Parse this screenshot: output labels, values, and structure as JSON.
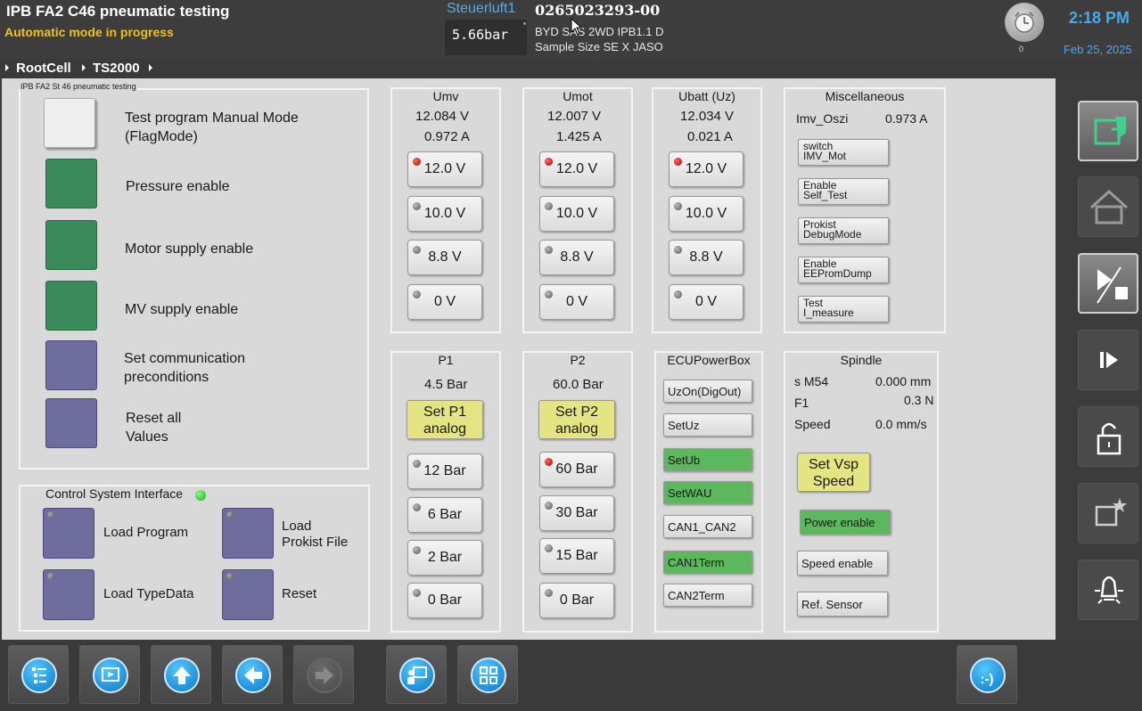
{
  "header": {
    "title": "IPB FA2 C46 pneumatic testing",
    "status": "Automatic mode in progress",
    "station_label": "Steuerluft1",
    "station_value": "5.66bar",
    "part_number": "0265023293-00",
    "variant": "BYD SAS 2WD IPB1.1 D",
    "sample": "Sample Size SE  X JASO",
    "alarm_count": "0",
    "time": "2:18 PM",
    "date": "Feb 25, 2025"
  },
  "breadcrumb": [
    "RootCell",
    "TS2000"
  ],
  "flags": {
    "group_title": "IPB FA2 St 46 pneumatic testing",
    "items": [
      {
        "line1": "Test program Manual Mode",
        "line2": "(FlagMode)",
        "color": "#eeeeee"
      },
      {
        "line1": "Pressure enable",
        "line2": "",
        "color": "#3b8a5c"
      },
      {
        "line1": "Motor supply enable",
        "line2": "",
        "color": "#3b8a5c"
      },
      {
        "line1": "MV supply enable",
        "line2": "",
        "color": "#3b8a5c"
      },
      {
        "line1": "Set communication",
        "line2": "preconditions",
        "color": "#6f6d9e"
      },
      {
        "line1": "Reset all",
        "line2": "Values",
        "color": "#6f6d9e"
      }
    ]
  },
  "control": {
    "title": "Control System Interface",
    "status_color": "#33cc33",
    "buttons": [
      {
        "line1": "Load Program",
        "line2": ""
      },
      {
        "line1": "Load",
        "line2": "Prokist File"
      },
      {
        "line1": "Load TypeData",
        "line2": ""
      },
      {
        "line1": "Reset",
        "line2": ""
      }
    ]
  },
  "voltage_panels": [
    {
      "title": "Umv",
      "voltage": "12.084 V",
      "current": "0.972 A",
      "buttons": [
        {
          "label": "12.0 V",
          "active": true
        },
        {
          "label": "10.0 V",
          "active": false
        },
        {
          "label": "8.8 V",
          "active": false
        },
        {
          "label": "0 V",
          "active": false
        }
      ]
    },
    {
      "title": "Umot",
      "voltage": "12.007 V",
      "current": "1.425 A",
      "buttons": [
        {
          "label": "12.0 V",
          "active": true
        },
        {
          "label": "10.0 V",
          "active": false
        },
        {
          "label": "8.8 V",
          "active": false
        },
        {
          "label": "0 V",
          "active": false
        }
      ]
    },
    {
      "title": "Ubatt (Uz)",
      "voltage": "12.034 V",
      "current": "0.021 A",
      "buttons": [
        {
          "label": "12.0 V",
          "active": true
        },
        {
          "label": "10.0 V",
          "active": false
        },
        {
          "label": "8.8 V",
          "active": false
        },
        {
          "label": "0 V",
          "active": false
        }
      ]
    }
  ],
  "misc": {
    "title": "Miscellaneous",
    "imv_label": "Imv_Oszi",
    "imv_value": "0.973 A",
    "buttons": [
      {
        "line1": "switch",
        "line2": "IMV_Mot"
      },
      {
        "line1": "Enable",
        "line2": "Self_Test"
      },
      {
        "line1": "Prokist",
        "line2": "DebugMode"
      },
      {
        "line1": "Enable",
        "line2": "EEPromDump"
      },
      {
        "line1": "Test",
        "line2": "I_measure"
      }
    ]
  },
  "pressure_panels": [
    {
      "title": "P1",
      "value": "4.5 Bar",
      "set_line1": "Set P1",
      "set_line2": "analog",
      "buttons": [
        {
          "label": "12 Bar",
          "active": false
        },
        {
          "label": "6 Bar",
          "active": false
        },
        {
          "label": "2 Bar",
          "active": false
        },
        {
          "label": "0 Bar",
          "active": false
        }
      ]
    },
    {
      "title": "P2",
      "value": "60.0 Bar",
      "set_line1": "Set P2",
      "set_line2": "analog",
      "buttons": [
        {
          "label": "60 Bar",
          "active": true
        },
        {
          "label": "30 Bar",
          "active": false
        },
        {
          "label": "15 Bar",
          "active": false
        },
        {
          "label": "0 Bar",
          "active": false
        }
      ]
    }
  ],
  "ecu": {
    "title": "ECUPowerBox",
    "buttons": [
      {
        "label": "UzOn(DigOut)",
        "on": false
      },
      {
        "label": "SetUz",
        "on": false
      },
      {
        "label": "SetUb",
        "on": true
      },
      {
        "label": "SetWAU",
        "on": true
      },
      {
        "label": "CAN1_CAN2",
        "on": false
      },
      {
        "label": "CAN1Term",
        "on": true
      },
      {
        "label": "CAN2Term",
        "on": false
      }
    ],
    "on_color": "#5cb85c"
  },
  "spindle": {
    "title": "Spindle",
    "rows": [
      {
        "label": "s M54",
        "value": "0.000 mm"
      },
      {
        "label": "F1",
        "value": "0.3 N"
      },
      {
        "label": "Speed",
        "value": "0.0 mm/s"
      }
    ],
    "set_line1": "Set Vsp",
    "set_line2": "Speed",
    "power_enable": "Power enable",
    "speed_enable": "Speed enable",
    "ref_sensor": "Ref. Sensor"
  },
  "sidebar_icons": [
    "export-icon",
    "home-icon",
    "run-stop-icon",
    "step-icon",
    "unlock-icon",
    "special-icon",
    "light-icon"
  ],
  "bottom_icons": [
    "program-list-icon",
    "monitor-icon",
    "up-arrow-icon",
    "back-arrow-icon",
    "forward-arrow-icon",
    "operator-icon",
    "grid-icon",
    "smiley-icon"
  ],
  "bottom_smiley": ":-)",
  "colors": {
    "accent_blue": "#44aaee",
    "status_yellow": "#f0c020",
    "led_red": "#cc0000",
    "flag_green": "#3b8a5c",
    "flag_purple": "#6f6d9e",
    "set_yellow": "#e4e482"
  }
}
